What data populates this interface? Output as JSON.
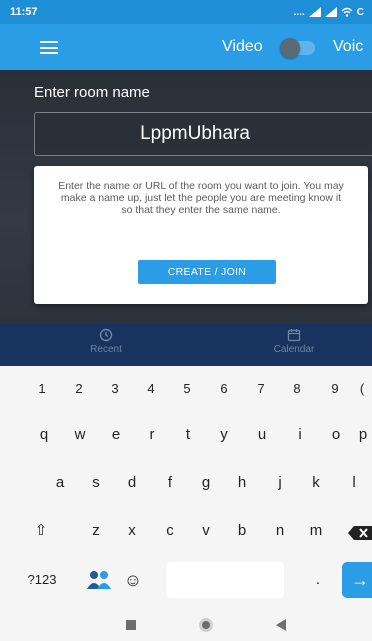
{
  "status_bar": {
    "time": "11:57",
    "signal_text": "....",
    "battery_label": "C"
  },
  "app_bar": {
    "video_label": "Video",
    "voice_label": "Voic",
    "toggle_on": false
  },
  "room": {
    "label": "Enter room name",
    "value": "LppmUbhara"
  },
  "info_card": {
    "text": "Enter the name or URL of the room you want to join. You may make a name up, just let the people you are meeting know it so that they enter the same name.",
    "button_label": "CREATE / JOIN"
  },
  "tabs": {
    "recent": "Recent",
    "calendar": "Calendar"
  },
  "keyboard": {
    "number_row": [
      "1",
      "2",
      "3",
      "4",
      "5",
      "6",
      "7",
      "8",
      "9",
      "("
    ],
    "row1": [
      "q",
      "w",
      "e",
      "r",
      "t",
      "y",
      "u",
      "i",
      "o",
      "p"
    ],
    "row2": [
      "a",
      "s",
      "d",
      "f",
      "g",
      "h",
      "j",
      "k",
      "l"
    ],
    "row3": [
      "z",
      "x",
      "c",
      "v",
      "b",
      "n",
      "m"
    ],
    "symbols_key": "?123",
    "period_key": ".",
    "shift_icon": "⇧",
    "emoji_icon": "☺",
    "enter_icon": "→"
  },
  "colors": {
    "accent": "#2b9de7",
    "status_bar": "#1e8fd6",
    "dark_bg": "#2f353e",
    "tab_bar": "#18335e"
  }
}
